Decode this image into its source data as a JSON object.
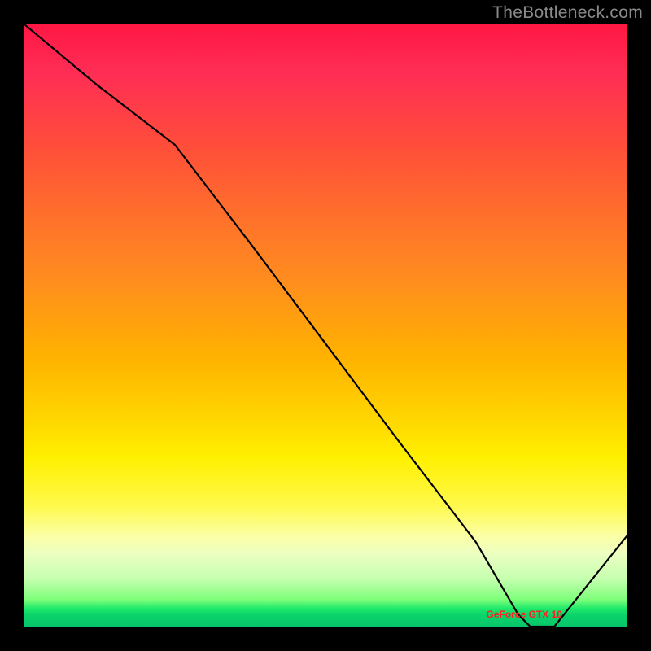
{
  "watermark": "TheBottleneck.com",
  "marker_text": "GeForce GTX 10",
  "chart_data": {
    "type": "line",
    "title": "",
    "xlabel": "",
    "ylabel": "",
    "x_range": [
      0,
      100
    ],
    "y_range": [
      0,
      100
    ],
    "background": "red-yellow-green vertical performance gradient",
    "series": [
      {
        "name": "bottleneck-curve",
        "x": [
          0,
          12,
          25,
          38,
          50,
          62,
          75,
          82,
          84,
          88,
          100
        ],
        "y": [
          100,
          90,
          80,
          63,
          47,
          31,
          14,
          2,
          0,
          0,
          15
        ],
        "comment": "y=0 is bottom (green zone). Curve descends steeply from top-left, flattens to minimum around x≈84-88, then rises toward lower-right corner."
      }
    ],
    "annotations": [
      {
        "name": "optimal-gpu-marker",
        "x": 83,
        "y": 2,
        "text": "GeForce GTX 10"
      }
    ]
  }
}
